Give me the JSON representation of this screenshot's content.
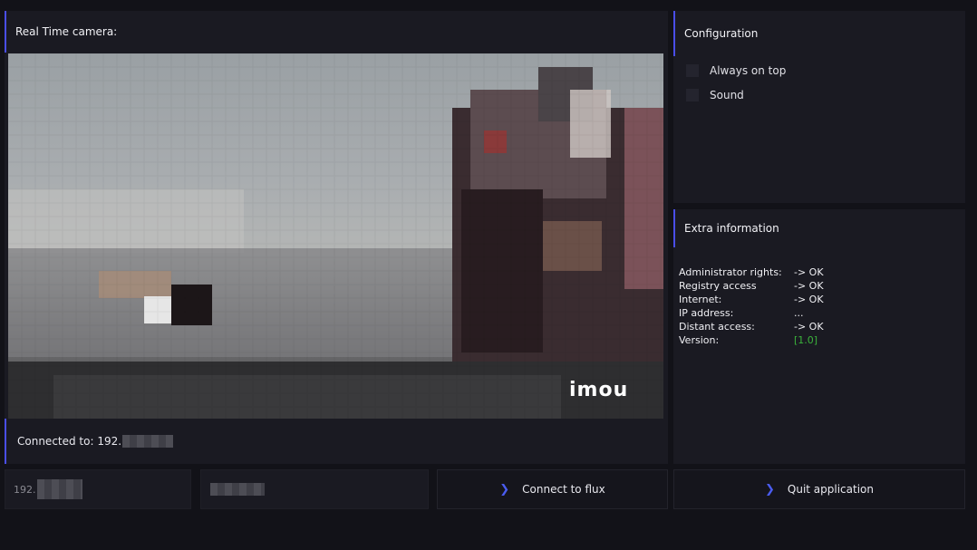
{
  "camera": {
    "title": "Real Time camera:",
    "watermark": "imou",
    "status_prefix": "Connected to: 192."
  },
  "config": {
    "title": "Configuration",
    "options": [
      {
        "label": "Always on top",
        "checked": false
      },
      {
        "label": "Sound",
        "checked": false
      }
    ]
  },
  "extra": {
    "title": "Extra information",
    "rows": [
      {
        "key": "Administrator rights:",
        "value": "-> OK"
      },
      {
        "key": "Registry access",
        "value": "-> OK"
      },
      {
        "key": "Internet:",
        "value": "-> OK"
      },
      {
        "key": "IP address:",
        "value": "..."
      },
      {
        "key": "Distant access:",
        "value": "-> OK"
      },
      {
        "key": "Version:",
        "value": "[1.0]"
      }
    ]
  },
  "inputs": {
    "ip_value": "192.",
    "port_value": ""
  },
  "buttons": {
    "connect": "Connect to flux",
    "quit": "Quit application"
  },
  "colors": {
    "accent": "#4a4ee8",
    "version_green": "#3bb33b"
  }
}
